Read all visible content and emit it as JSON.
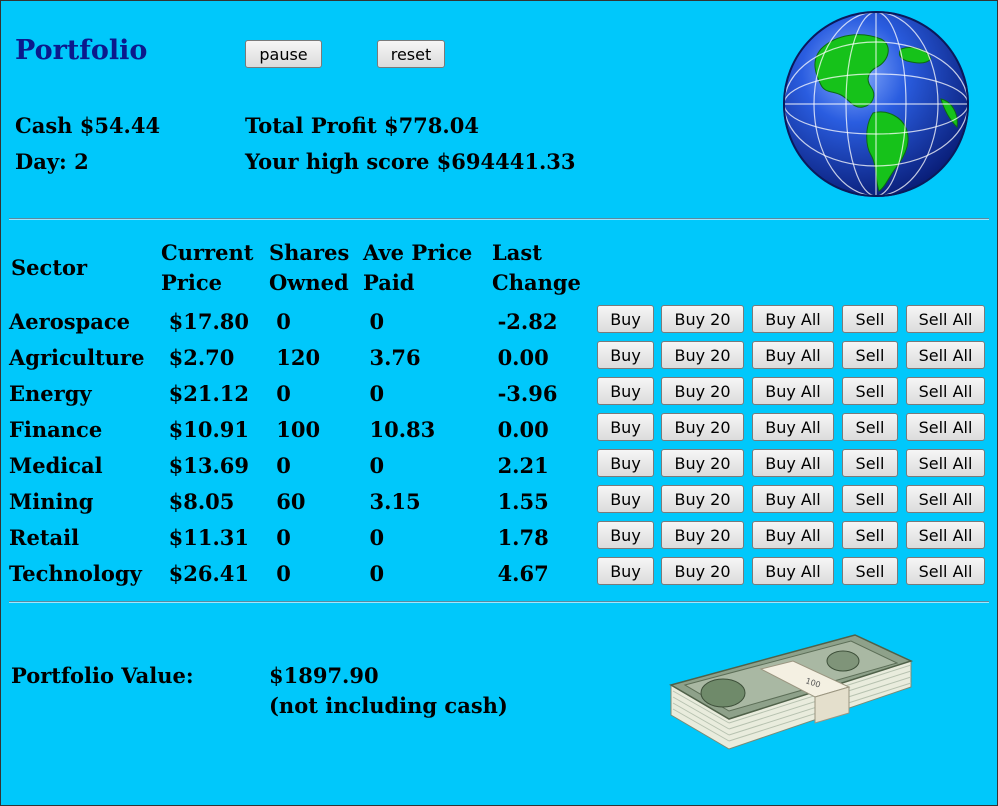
{
  "header": {
    "title": "Portfolio",
    "pause_label": "pause",
    "reset_label": "reset",
    "cash": "Cash $54.44",
    "day": "Day: 2",
    "total_profit": "Total Profit $778.04",
    "high_score": "Your high score $694441.33"
  },
  "table": {
    "headers": {
      "sector": "Sector",
      "price_1": "Current",
      "price_2": "Price",
      "owned_1": "Shares",
      "owned_2": "Owned",
      "ave_1": "Ave Price",
      "ave_2": "Paid",
      "change_1": "Last",
      "change_2": "Change"
    },
    "button_labels": {
      "buy": "Buy",
      "buy20": "Buy 20",
      "buyall": "Buy All",
      "sell": "Sell",
      "sellall": "Sell All"
    },
    "rows": [
      {
        "sector": "Aerospace",
        "price": "$17.80",
        "owned": "0",
        "ave": "0",
        "change": "-2.82"
      },
      {
        "sector": "Agriculture",
        "price": "$2.70",
        "owned": "120",
        "ave": "3.76",
        "change": "0.00"
      },
      {
        "sector": "Energy",
        "price": "$21.12",
        "owned": "0",
        "ave": "0",
        "change": "-3.96"
      },
      {
        "sector": "Finance",
        "price": "$10.91",
        "owned": "100",
        "ave": "10.83",
        "change": "0.00"
      },
      {
        "sector": "Medical",
        "price": "$13.69",
        "owned": "0",
        "ave": "0",
        "change": "2.21"
      },
      {
        "sector": "Mining",
        "price": "$8.05",
        "owned": "60",
        "ave": "3.15",
        "change": "1.55"
      },
      {
        "sector": "Retail",
        "price": "$11.31",
        "owned": "0",
        "ave": "0",
        "change": "1.78"
      },
      {
        "sector": "Technology",
        "price": "$26.41",
        "owned": "0",
        "ave": "0",
        "change": "4.67"
      }
    ]
  },
  "footer": {
    "portfolio_label": "Portfolio Value:",
    "portfolio_value": "$1897.90",
    "note": "(not including cash)"
  },
  "colors": {
    "background": "#00c8fb",
    "title": "#0b1a8c",
    "globe_ocean": "#1a4fd8",
    "globe_land": "#16c21a",
    "money_green": "#6f8a6a"
  },
  "images": {
    "globe": "globe-icon",
    "money": "money-stack-icon"
  }
}
